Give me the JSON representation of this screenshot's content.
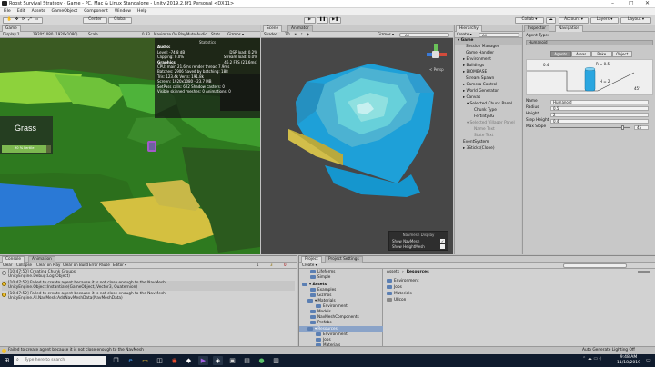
{
  "window": {
    "title": "Roost Survival Strategy - Game - PC, Mac & Linux Standalone - Unity 2019.2.8f1 Personal <DX11>",
    "min": "–",
    "max": "□",
    "close": "✕"
  },
  "menu": [
    "File",
    "Edit",
    "Assets",
    "GameObject",
    "Component",
    "Window",
    "Help"
  ],
  "toolbar": {
    "pivot": "Center",
    "space": "Global",
    "play": "▶",
    "pause": "❚❚",
    "step": "▶❚",
    "collab": "Collab ▾",
    "cloud": "☁",
    "account": "Account ▾",
    "layers": "Layers ▾",
    "layout": "Layout ▾"
  },
  "game_view": {
    "tab": "Game",
    "display": "Display 1",
    "resolution": "1920*1080 (1920x1080)",
    "scale_label": "Scale",
    "scale_value": "0.33",
    "maximize": "Maximize On Play",
    "mute": "Mute Audio",
    "stats": "Stats",
    "gizmos": "Gizmos ▾",
    "tooltip_title": "Grass",
    "tooltip_sub": "90 % Fertile",
    "stats_panel": {
      "header": "Statistics",
      "audio_label": "Audio:",
      "level": "Level: -74.8 dB",
      "clipping": "Clipping: 0.0%",
      "dsp": "DSP load: 0.2%",
      "stream": "Stream load: 0.0%",
      "graphics_label": "Graphics:",
      "fps": "46.2 FPS (21.6ms)",
      "cpu": "CPU: main 21.6ms  render thread 7.9ms",
      "batches": "Batches: 2906   Saved by batching: 188",
      "tris": "Tris: 123.4k   Verts: 191.8k",
      "screen": "Screen: 1920x1080 - 23.7 MB",
      "setpass": "SetPass calls: 622   Shadow casters: 0",
      "skinned": "Visible skinned meshes: 0  Animations: 0"
    }
  },
  "scene_view": {
    "tabs": [
      "Scene",
      "Animator"
    ],
    "shaded": "Shaded",
    "mode2d": "2D",
    "gizmos": "Gizmos ▾",
    "search": "All",
    "persp": "< Persp",
    "navmesh_panel": {
      "title": "Navmesh Display",
      "show_navmesh": "Show NavMesh",
      "show_heightmesh": "Show HeightMesh"
    }
  },
  "hierarchy": {
    "tab": "Hierarchy",
    "create": "Create ▾",
    "search": "All",
    "items": [
      "▾ Game",
      "Session Manager",
      "Game Handler",
      "▸ Environment",
      "▸ Buildings",
      "▸ BIOMBASE",
      "Stream Spawn",
      "▸ Camera Control",
      "▸ World Generator",
      "▸ Canvas",
      "▾ Selected Chunk Panel",
      "Chunk Type",
      "FertilityBG",
      "▾ Selected Villager Panel",
      "Name Text",
      "State Text",
      "EventSystem",
      "▸ 3Sticks(Clone)"
    ]
  },
  "inspector": {
    "tabs": [
      "Inspector",
      "Navigation"
    ],
    "agent_types_label": "Agent Types",
    "agent_type": "Humanoid",
    "nav_tabs": [
      "Agents",
      "Areas",
      "Bake",
      "Object"
    ],
    "diagram": {
      "r_label": "R = 0.5",
      "h_label": "H = 2",
      "slope": "45°",
      "step": "0.4"
    },
    "fields": [
      {
        "label": "Name",
        "value": "Humanoid"
      },
      {
        "label": "Radius",
        "value": "0.5"
      },
      {
        "label": "Height",
        "value": "2"
      },
      {
        "label": "Step Height",
        "value": "0.4"
      },
      {
        "label": "Max Slope",
        "value": "45"
      }
    ]
  },
  "console": {
    "tabs": [
      "Console",
      "Animation"
    ],
    "buttons": [
      "Clear",
      "Collapse",
      "Clear on Play",
      "Clear on Build",
      "Error Pause",
      "Editor ▾"
    ],
    "counts": {
      "log": "1",
      "warn": "3",
      "error": "0"
    },
    "rows": [
      {
        "line1": "[10:47:50] Creating Chunk Groups",
        "line2": "UnityEngine.Debug:Log(Object)"
      },
      {
        "line1": "[10:47:52] Failed to create agent because it is not close enough to the NavMesh",
        "line2": "UnityEngine.Object:Instantiate(GameObject, Vector3, Quaternion)"
      },
      {
        "line1": "[10:47:52] Failed to create agent because it is not close enough to the NavMesh",
        "line2": "UnityEngine.AI.NavMesh:AddNavMeshData(NavMeshData)"
      }
    ],
    "status": "Failed to create agent because it is not close enough to the NavMesh"
  },
  "project": {
    "tabs": [
      "Project",
      "Project Settings"
    ],
    "create": "Create ▾",
    "tree": [
      "Lifeforms",
      "Simple",
      "▾ Assets",
      "Examples",
      "Gizmos",
      "▾ Materials",
      "Environment",
      "Models",
      "NavMeshComponents",
      "Prefabs",
      "▾ Resources",
      "Environment",
      "Jobs",
      "Materials"
    ],
    "breadcrumb": [
      "Assets",
      "Resources"
    ],
    "files": [
      "Environment",
      "Jobs",
      "Materials",
      "UIIcon"
    ],
    "status": "Auto Generate Lighting Off"
  },
  "taskbar": {
    "search_placeholder": "Type here to search",
    "time": "9:48 AM",
    "date": "11/18/2019"
  },
  "colors": {
    "ocean": "#1fa0d8",
    "grass": "#3fa52a",
    "sand": "#d2be4a",
    "navmesh": "#55c9d3",
    "taskbar": "#0f1b2d"
  }
}
